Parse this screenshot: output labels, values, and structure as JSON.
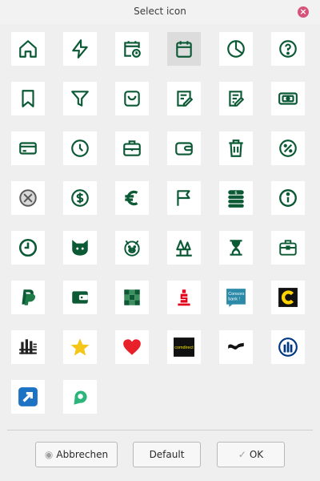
{
  "window": {
    "title": "Select icon"
  },
  "colors": {
    "icon_green": "#0b5a35",
    "selected_bg": "#dcdcdc"
  },
  "icons": [
    "home-icon",
    "flash-icon",
    "calendar-clock-icon",
    "calendar-icon",
    "pie-chart-icon",
    "help-circle-icon",
    "bookmark-icon",
    "filter-icon",
    "shopping-basket-icon",
    "edit-note-icon",
    "edit-document-icon",
    "banknote-icon",
    "credit-card-icon",
    "clock-icon",
    "briefcase-icon",
    "wallet-icon",
    "trash-icon",
    "percent-icon",
    "cancel-circle-icon",
    "dollar-circle-icon",
    "euro-icon",
    "flag-icon",
    "coin-stack-icon",
    "info-circle-icon",
    "timer-icon",
    "cat-icon",
    "piggy-bank-icon",
    "trees-icon",
    "hourglass-icon",
    "toolbox-icon",
    "paypal-icon",
    "wallet-card-icon",
    "checkered-logo-icon",
    "sparkasse-logo-icon",
    "consorsbank-logo-icon",
    "c-logo-icon",
    "bar-logo-icon",
    "star-icon",
    "heart-icon",
    "comdirect-logo-icon",
    "wave-logo-icon",
    "allianz-logo-icon",
    "arrow-logo-icon",
    "map-pin-logo-icon"
  ],
  "selected_icon": "calendar-icon",
  "logo_text": {
    "comdirect": "comdirect",
    "consors_line1": "Consors",
    "consors_line2": "bank !"
  },
  "buttons": {
    "cancel": "Abbrechen",
    "default": "Default",
    "ok": "OK"
  }
}
